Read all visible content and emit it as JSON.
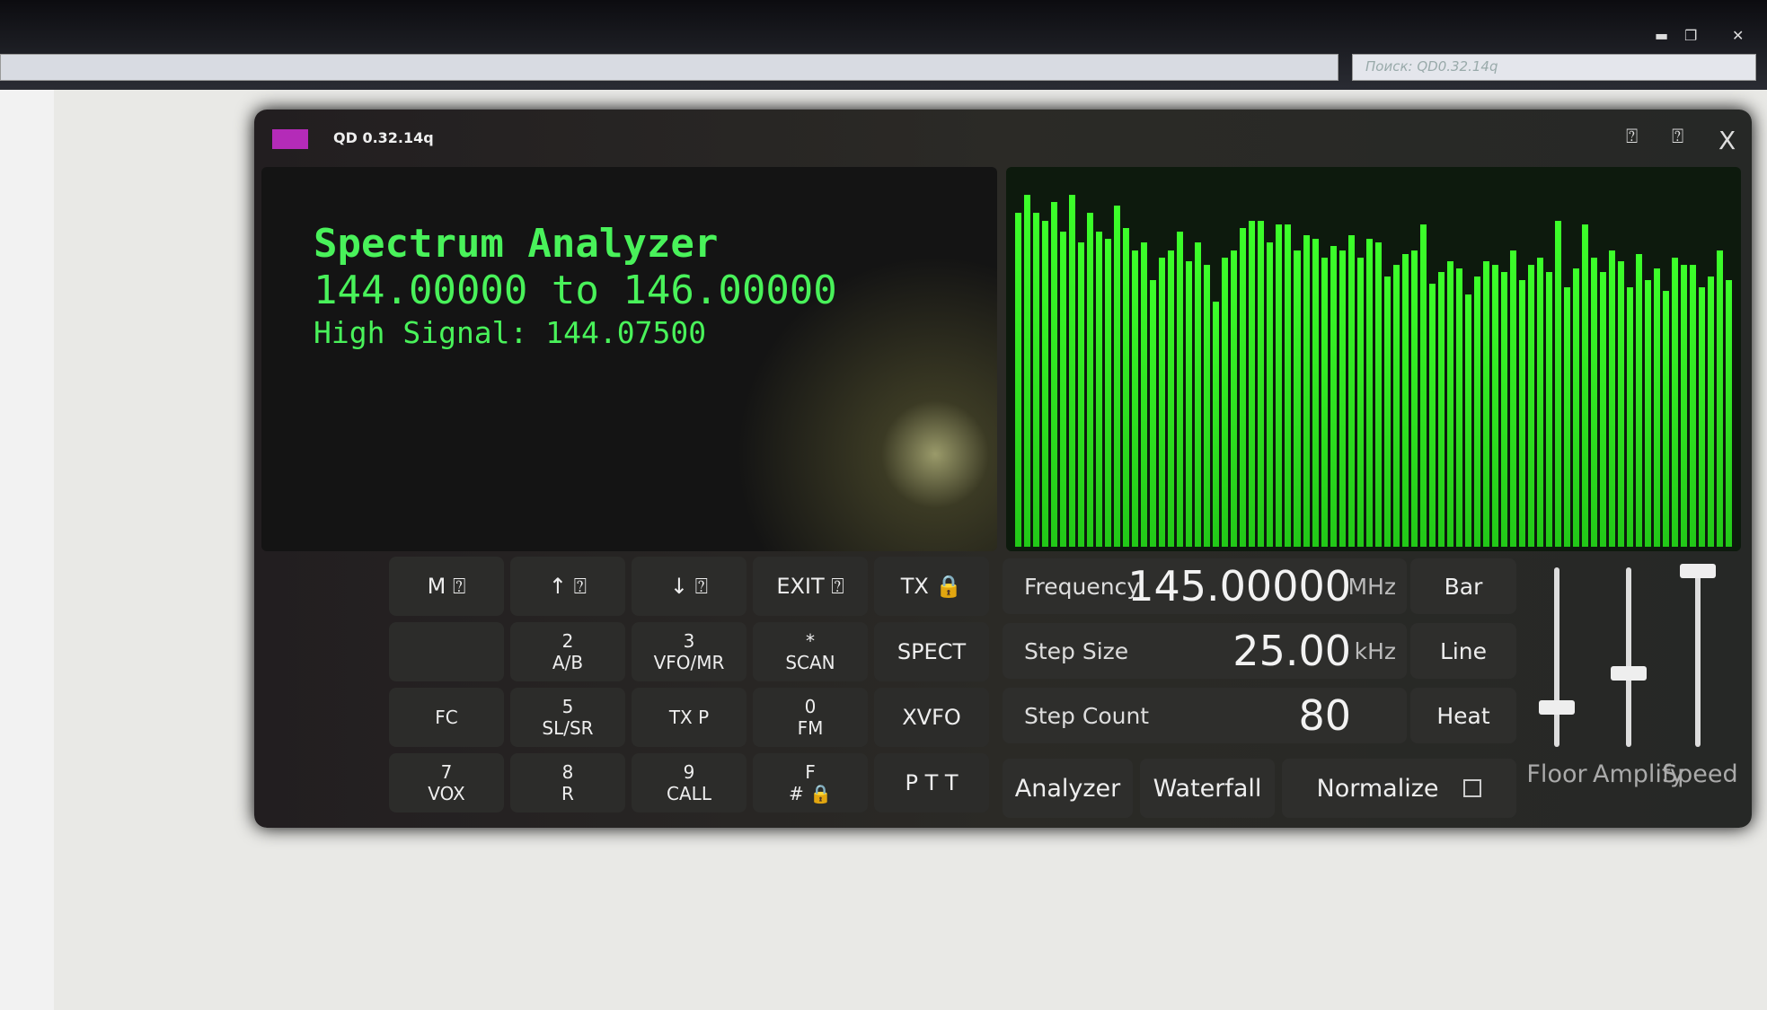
{
  "browser": {
    "search_placeholder": "Поиск: QD0.32.14q"
  },
  "window": {
    "title": "QD 0.32.14q",
    "accent": "#b42bb8",
    "help_label": "⍰",
    "pin_label": "⍰",
    "close_label": "X"
  },
  "display": {
    "title": "Spectrum Analyzer",
    "range": "144.00000 to 146.00000",
    "peak": "High Signal: 144.07500",
    "text_color": "#49f25a"
  },
  "spectrum": {
    "mode": "bar",
    "bar_color": "#3cff2a",
    "levels": [
      0.9,
      0.95,
      0.9,
      0.88,
      0.93,
      0.85,
      0.95,
      0.82,
      0.9,
      0.85,
      0.83,
      0.92,
      0.86,
      0.8,
      0.82,
      0.72,
      0.78,
      0.8,
      0.85,
      0.77,
      0.82,
      0.76,
      0.66,
      0.78,
      0.8,
      0.86,
      0.88,
      0.88,
      0.82,
      0.87,
      0.87,
      0.8,
      0.84,
      0.83,
      0.78,
      0.81,
      0.8,
      0.84,
      0.78,
      0.83,
      0.82,
      0.73,
      0.76,
      0.79,
      0.8,
      0.87,
      0.71,
      0.74,
      0.77,
      0.75,
      0.68,
      0.73,
      0.77,
      0.76,
      0.74,
      0.8,
      0.72,
      0.76,
      0.78,
      0.74,
      0.88,
      0.7,
      0.75,
      0.87,
      0.78,
      0.74,
      0.8,
      0.77,
      0.7,
      0.79,
      0.72,
      0.75,
      0.69,
      0.78,
      0.76,
      0.76,
      0.7,
      0.73,
      0.8,
      0.72
    ]
  },
  "keypad": [
    {
      "top": "M ⍰",
      "bottom": ""
    },
    {
      "top": "↑ ⍰",
      "bottom": ""
    },
    {
      "top": "↓ ⍰",
      "bottom": ""
    },
    {
      "top": "EXIT ⍰",
      "bottom": ""
    },
    {
      "top": "TX 🔒",
      "bottom": ""
    },
    {
      "top": "",
      "bottom": ""
    },
    {
      "top": "2",
      "bottom": "A/B"
    },
    {
      "top": "3",
      "bottom": "VFO/MR"
    },
    {
      "top": "*",
      "bottom": "SCAN"
    },
    {
      "top": "SPECT",
      "bottom": ""
    },
    {
      "top": "",
      "bottom": "FC"
    },
    {
      "top": "5",
      "bottom": "SL/SR"
    },
    {
      "top": "",
      "bottom": "TX P"
    },
    {
      "top": "0",
      "bottom": "FM"
    },
    {
      "top": "XVFO",
      "bottom": ""
    },
    {
      "top": "7",
      "bottom": "VOX"
    },
    {
      "top": "8",
      "bottom": "R"
    },
    {
      "top": "9",
      "bottom": "CALL"
    },
    {
      "top": "F",
      "bottom": "# 🔒"
    },
    {
      "top": "P T T",
      "bottom": ""
    }
  ],
  "settings": {
    "frequency": {
      "label": "Frequency",
      "value": "145.00000",
      "unit": "MHz"
    },
    "step_size": {
      "label": "Step Size",
      "value": "25.00",
      "unit": "kHz"
    },
    "step_count": {
      "label": "Step Count",
      "value": "80"
    }
  },
  "modes": {
    "bar": "Bar",
    "line": "Line",
    "heat": "Heat"
  },
  "bottom": {
    "analyzer": "Analyzer",
    "waterfall": "Waterfall",
    "normalize": "Normalize",
    "normalize_checked": false
  },
  "sliders": {
    "floor": {
      "label": "Floor",
      "level": 0.2
    },
    "amplify": {
      "label": "Amplify",
      "level": 0.4
    },
    "speed": {
      "label": "Speed",
      "level": 1.0
    }
  }
}
